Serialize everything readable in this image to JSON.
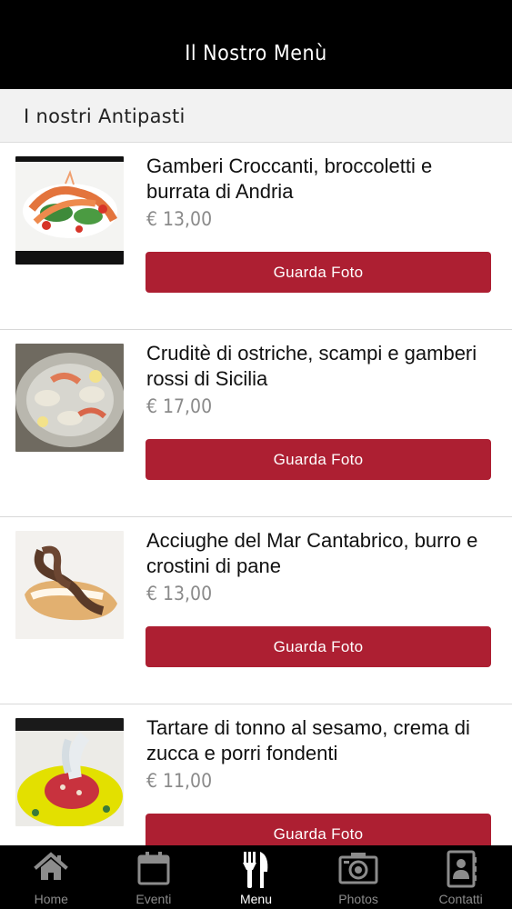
{
  "header": {
    "title": "Il Nostro Menù"
  },
  "section": {
    "title": "I nostri Antipasti"
  },
  "items": [
    {
      "name": "Gamberi Croccanti, broccoletti e burrata di Andria",
      "price": "€ 13,00",
      "button": "Guarda Foto"
    },
    {
      "name": "Cruditè di ostriche, scampi e gamberi rossi di Sicilia",
      "price": "€ 17,00",
      "button": "Guarda Foto"
    },
    {
      "name": "Acciughe del Mar Cantabrico, burro e crostini di pane",
      "price": "€ 13,00",
      "button": "Guarda Foto"
    },
    {
      "name": "Tartare di tonno al sesamo, crema di zucca e porri fondenti",
      "price": "€ 11,00",
      "button": "Guarda Foto"
    }
  ],
  "tabs": [
    {
      "label": "Home",
      "icon": "home-icon"
    },
    {
      "label": "Eventi",
      "icon": "calendar-icon"
    },
    {
      "label": "Menu",
      "icon": "fork-knife-icon",
      "active": true
    },
    {
      "label": "Photos",
      "icon": "camera-icon"
    },
    {
      "label": "Contatti",
      "icon": "contacts-icon"
    }
  ],
  "colors": {
    "accent": "#ad1f32",
    "header_bg": "#000000",
    "tab_inactive": "#8c8c8c"
  }
}
